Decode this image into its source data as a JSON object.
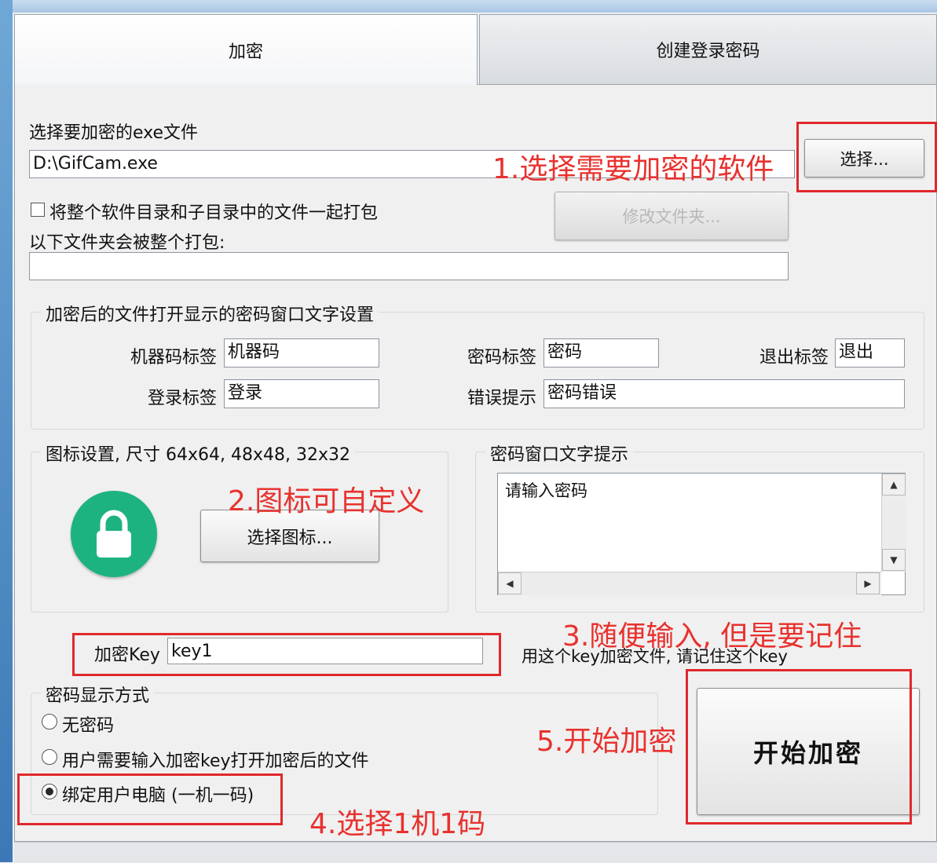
{
  "tabs": [
    {
      "label": "加密",
      "active": true
    },
    {
      "label": "创建登录密码",
      "active": false
    }
  ],
  "file_section": {
    "label": "选择要加密的exe文件",
    "path_value": "D:\\GifCam.exe",
    "choose_button": "选择...",
    "pack_checkbox_label": "将整个软件目录和子目录中的文件一起打包",
    "pack_checked": false,
    "folder_label": "以下文件夹会被整个打包:",
    "folder_value": "",
    "modify_folder_button": "修改文件夹..."
  },
  "password_window": {
    "legend": "加密后的文件打开显示的密码窗口文字设置",
    "machine_code_label": "机器码标签",
    "machine_code_value": "机器码",
    "password_label": "密码标签",
    "password_value": "密码",
    "exit_label": "退出标签",
    "exit_value": "退出",
    "login_label": "登录标签",
    "login_value": "登录",
    "error_label": "错误提示",
    "error_value": "密码错误"
  },
  "icon_settings": {
    "legend": "图标设置, 尺寸 64x64, 48x48, 32x32",
    "choose_icon_button": "选择图标...",
    "icon": "lock-icon",
    "icon_color": "#1db381"
  },
  "prompt_text": {
    "legend": "密码窗口文字提示",
    "value": "请输入密码"
  },
  "key": {
    "label": "加密Key",
    "value": "key1",
    "hint": "用这个key加密文件, 请记住这个key"
  },
  "display_mode": {
    "legend": "密码显示方式",
    "options": [
      {
        "label": "无密码",
        "checked": false
      },
      {
        "label": "用户需要输入加密key打开加密后的文件",
        "checked": false
      },
      {
        "label": "绑定用户电脑 (一机一码)",
        "checked": true
      }
    ]
  },
  "start_button": "开始加密",
  "annotations": {
    "a1": "1.选择需要加密的软件",
    "a2": "2.图标可自定义",
    "a3": "3.随便输入, 但是要记住",
    "a4": "4.选择1机1码",
    "a5": "5.开始加密",
    "color": "#e8322e"
  }
}
